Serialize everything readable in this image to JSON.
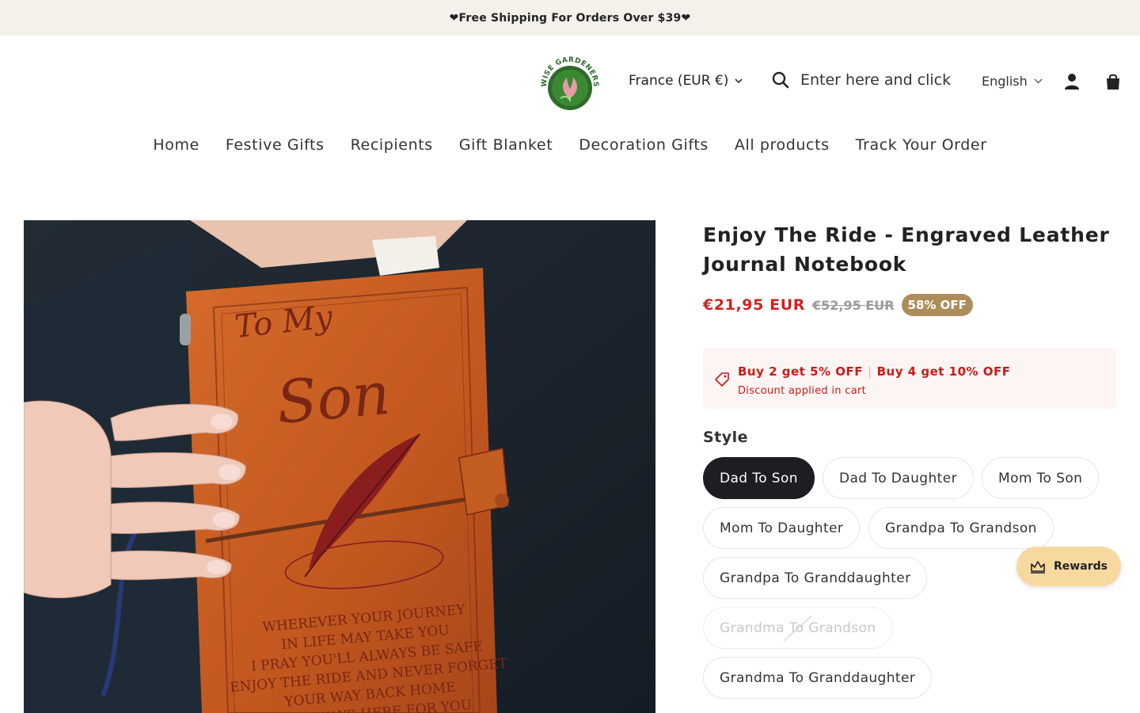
{
  "announcement": "❤Free Shipping For Orders Over $39❤",
  "brand": {
    "logo_text": "WISE GARDENERS",
    "colors": {
      "ring": "#2e6b2a",
      "inner": "#3b8a33",
      "flower": "#e79aa7"
    }
  },
  "header": {
    "currency": "France (EUR €)",
    "search_placeholder": "Enter here and click",
    "language": "English"
  },
  "nav": {
    "items": [
      "Home",
      "Festive Gifts",
      "Recipients",
      "Gift Blanket",
      "Decoration Gifts",
      "All products",
      "Track Your Order"
    ]
  },
  "product": {
    "title": "Enjoy The Ride - Engraved Leather Journal Notebook",
    "price": "€21,95 EUR",
    "compare_price": "€52,95 EUR",
    "discount_badge": "58% OFF",
    "image_text": {
      "to_my": "To My",
      "recipient": "Son",
      "poem": [
        "WHEREVER YOUR JOURNEY",
        "IN LIFE MAY TAKE YOU",
        "I PRAY YOU'LL ALWAYS BE SAFE",
        "ENJOY THE RIDE AND NEVER FORGET",
        "YOUR WAY BACK HOME",
        "I'M ALWAYS HERE FOR YOU"
      ]
    }
  },
  "promo": {
    "offer1": "Buy 2 get 5% OFF",
    "offer2": "Buy 4 get 10% OFF",
    "note": "Discount applied in cart"
  },
  "style": {
    "label": "Style",
    "options": [
      {
        "label": "Dad To Son",
        "state": "selected"
      },
      {
        "label": "Dad To Daughter",
        "state": "available"
      },
      {
        "label": "Mom To Son",
        "state": "available"
      },
      {
        "label": "Mom To Daughter",
        "state": "available"
      },
      {
        "label": "Grandpa To Grandson",
        "state": "available"
      },
      {
        "label": "Grandpa To Granddaughter",
        "state": "available"
      },
      {
        "label": "Grandma To Grandson",
        "state": "sold-out"
      },
      {
        "label": "Grandma To Granddaughter",
        "state": "available"
      }
    ]
  },
  "rewards": {
    "label": "Rewards"
  },
  "colors": {
    "sale_red": "#d32222",
    "badge_gold": "#ad8e5a",
    "selected_pill": "#1d1d22",
    "rewards_bg": "#f7d9a0"
  }
}
